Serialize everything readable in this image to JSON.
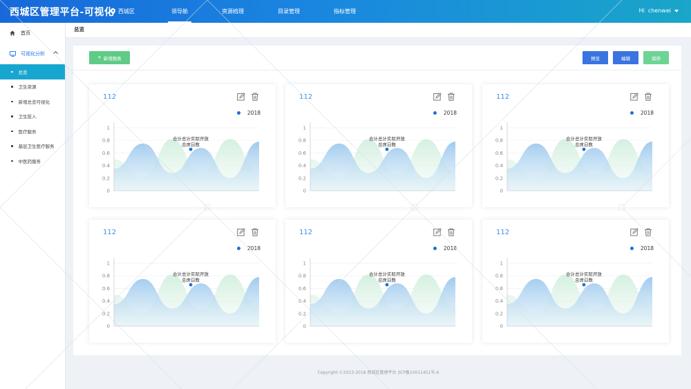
{
  "header": {
    "brand": "西城区管理平台-可视化",
    "location": "西城区",
    "nav": [
      "领导舱",
      "资源梳理",
      "目录管理",
      "指标管理"
    ],
    "user_greeting": "Hi",
    "username": "chenwei"
  },
  "sidebar": {
    "home": "首页",
    "group": "可视化分析",
    "items": [
      "总览",
      "卫生资源",
      "新增总览可视化",
      "卫生投入",
      "医疗服务",
      "基层卫生医疗服务",
      "中医药服务"
    ]
  },
  "breadcrumb": "总览",
  "toolbar": {
    "add_label": "新增图表",
    "preview_label": "预览",
    "edit_label": "编辑",
    "save_label": "保存"
  },
  "cards": [
    {
      "title": "112",
      "legend": "2018",
      "tooltip_line1": "合计总计实际开放",
      "tooltip_line2": "总床日数"
    },
    {
      "title": "112",
      "legend": "2018",
      "tooltip_line1": "合计总计实际开放",
      "tooltip_line2": "总床日数"
    },
    {
      "title": "112",
      "legend": "2018",
      "tooltip_line1": "合计总计实际开放",
      "tooltip_line2": "总床日数"
    },
    {
      "title": "112",
      "legend": "2018",
      "tooltip_line1": "合计总计实际开放",
      "tooltip_line2": "总床日数"
    },
    {
      "title": "112",
      "legend": "2018",
      "tooltip_line1": "合计总计实际开放",
      "tooltip_line2": "总床日数"
    },
    {
      "title": "112",
      "legend": "2018",
      "tooltip_line1": "合计总计实际开放",
      "tooltip_line2": "总床日数"
    }
  ],
  "chart_data": {
    "type": "area",
    "title": "",
    "yticks": [
      "0",
      "0.2",
      "0.4",
      "0.6",
      "0.8",
      "1"
    ],
    "ylim": [
      0,
      1
    ],
    "grid": true,
    "legend_position": "top-right",
    "series": [
      {
        "name": "2018",
        "color": "#9cc8ee",
        "values": [
          0.35,
          0.75,
          0.28,
          0.68,
          0.2,
          0.78
        ]
      },
      {
        "color": "#cfeedd",
        "values": [
          0.5,
          0.2,
          0.82,
          0.25,
          0.82,
          0.3
        ]
      }
    ]
  },
  "footer": "Copyright ©2013-2018 西城区管理平台 |ICP备10011451号-6",
  "colors": {
    "accent": "#1a73e8",
    "header_start": "#1769d9",
    "header_end": "#19a6c9",
    "active_menu": "#17a6cf",
    "add_button": "#5fcb85"
  }
}
